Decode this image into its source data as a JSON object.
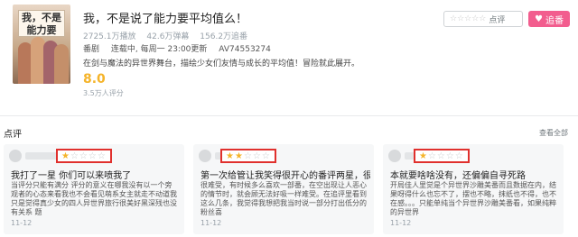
{
  "header": {
    "title": "我，不是说了能力要平均值么！",
    "cover_logo": "我，不是说了能力要平均值么！",
    "stats": [
      "2725.1万播放",
      "42.6万弹幕",
      "156.2万追番"
    ],
    "info": [
      "番剧",
      "连载中, 每周一 23:00更新",
      "AV74553274"
    ],
    "description": "在剑与魔法的异世界舞台，描绘少女们友情与成长的平均值！冒险就此展开。",
    "score": "8.0",
    "score_count": "3.5万人评分",
    "rate_label": "点评",
    "rate_stars": "☆☆☆☆☆",
    "follow_label": "追番",
    "follow_icon": "heart-icon"
  },
  "reviews_section": {
    "title": "点评",
    "view_more": "查看全部"
  },
  "reviews": [
    {
      "rating": 1,
      "headline": "我打了一星 你们可以来喷我了",
      "body": "当评分只能有满分 评分的意义在哪我没有以一个旁观者的心态来看我也不会看见萌系女主就走不动道我只是觉得真少女的四人异世界旅行很美好黑深残也没有关系 题",
      "date": "11-12"
    },
    {
      "rating": 2,
      "headline": "第一次给管让我笑得很开心的番评两星，很难受",
      "body": "很难受，有时候多么喜欢一部番，在空出现让人恶心的情节时，就会顾无法好吸一样难受。在追评里看到这么几条，我觉得我想把我当时说一部分打出低分的粉丝喜",
      "date": "11-12"
    },
    {
      "rating": 1,
      "headline": "本就要啥啥没有，还偏偏自寻死路",
      "body": "开局佳人里觉是个异世界沙雕美番而且数据在内，结果呀得什么也忘不了，摆也不略，抹纸也不得，也不在感。。。只能单纯当个异世界沙雕美番看，如果纯粹的异世界",
      "date": "11-12"
    }
  ]
}
